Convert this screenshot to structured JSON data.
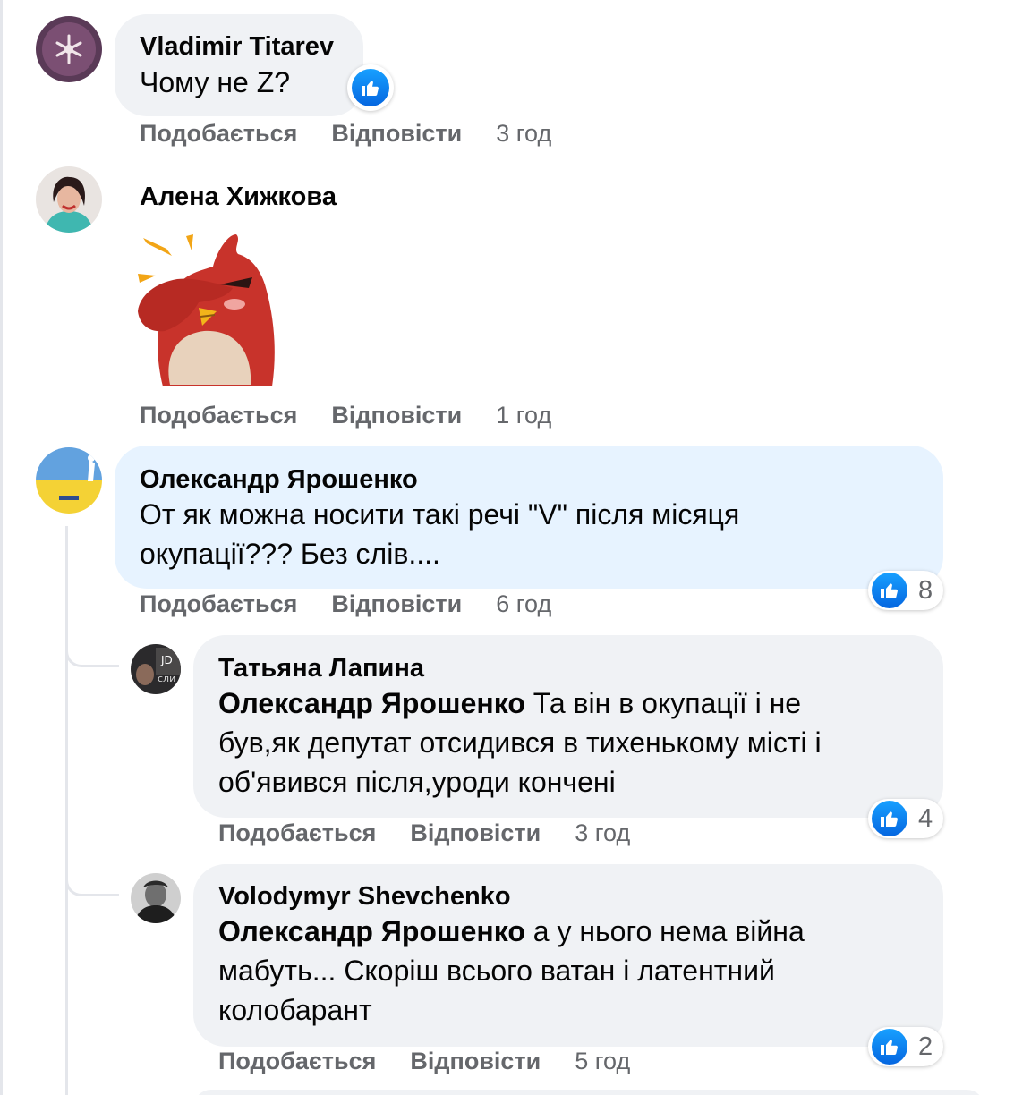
{
  "comments": [
    {
      "author": "Vladimir Titarev",
      "text": "Чому не Z?",
      "like_label": "Подобається",
      "reply_label": "Відповісти",
      "time": "3 год"
    },
    {
      "author": "Алена Хижкова",
      "sticker": "red-bird-facepalm-sticker",
      "like_label": "Подобається",
      "reply_label": "Відповісти",
      "time": "1 год"
    },
    {
      "author": "Олександр Ярошенко",
      "text_lines": [
        "От як можна носити такі речі \"V\" після місяця",
        "окупації??? Без слів...."
      ],
      "reactions": "8",
      "like_label": "Подобається",
      "reply_label": "Відповісти",
      "time": "6 год"
    }
  ],
  "replies": [
    {
      "author": "Татьяна Лапина",
      "mention": "Олександр Ярошенко",
      "text_first": " Та він в окупації і не",
      "text_lines": [
        "був,як депутат отсидився в тихенькому місті і",
        "об'явився після,уроди кончені"
      ],
      "reactions": "4",
      "like_label": "Подобається",
      "reply_label": "Відповісти",
      "time": "3 год"
    },
    {
      "author": "Volodymyr Shevchenko",
      "mention": "Олександр Ярошенко",
      "text_first": " а у нього нема війна",
      "text_lines": [
        "мабуть... Скоріш всього ватан і латентний",
        "колобарант"
      ],
      "reactions": "2",
      "like_label": "Подобається",
      "reply_label": "Відповісти",
      "time": "5 год"
    }
  ],
  "colors": {
    "bubble": "#f0f2f5",
    "bubble_highlight": "#e7f3ff",
    "meta_text": "#65676b",
    "like_blue": "#1877f2"
  },
  "icons": {
    "reaction": "thumbs-up-icon"
  }
}
